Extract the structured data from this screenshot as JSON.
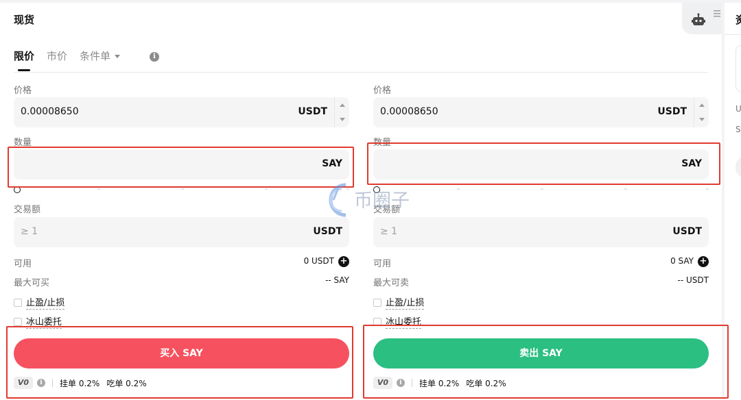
{
  "header": {
    "title": "现货",
    "robot_icon": "robot-icon",
    "menu_icon": "menu-dots-icon"
  },
  "tabs": [
    {
      "label": "限价",
      "active": true
    },
    {
      "label": "市价",
      "active": false
    },
    {
      "label": "条件单",
      "active": false,
      "has_dropdown": true
    }
  ],
  "buy": {
    "price_label": "价格",
    "price_value": "0.00008650",
    "price_unit": "USDT",
    "qty_label": "数量",
    "qty_value": "",
    "qty_unit": "SAY",
    "total_label": "交易额",
    "total_placeholder": "≥ 1",
    "total_unit": "USDT",
    "avail_label": "可用",
    "avail_value": "0 USDT",
    "max_label": "最大可买",
    "max_value": "-- SAY",
    "tpsl_label": "止盈/止损",
    "iceberg_label": "冰山委托",
    "action_label": "买入 SAY",
    "vip": "V0",
    "maker_fee": "挂单 0.2%",
    "taker_fee": "吃单 0.2%"
  },
  "sell": {
    "price_label": "价格",
    "price_value": "0.00008650",
    "price_unit": "USDT",
    "qty_label": "数量",
    "qty_value": "",
    "qty_unit": "SAY",
    "total_label": "交易额",
    "total_placeholder": "≥ 1",
    "total_unit": "USDT",
    "avail_label": "可用",
    "avail_value": "0 SAY",
    "max_label": "最大可卖",
    "max_value": "-- USDT",
    "tpsl_label": "止盈/止损",
    "iceberg_label": "冰山委托",
    "action_label": "卖出 SAY",
    "vip": "V0",
    "maker_fee": "挂单 0.2%",
    "taker_fee": "吃单 0.2%"
  },
  "right_panel": {
    "title": "资",
    "line1": "U",
    "line2": "S"
  },
  "watermark": {
    "text": "币圈子"
  },
  "colors": {
    "buy": "#f6515f",
    "sell": "#2bbf82",
    "highlight": "#e03a2f"
  }
}
